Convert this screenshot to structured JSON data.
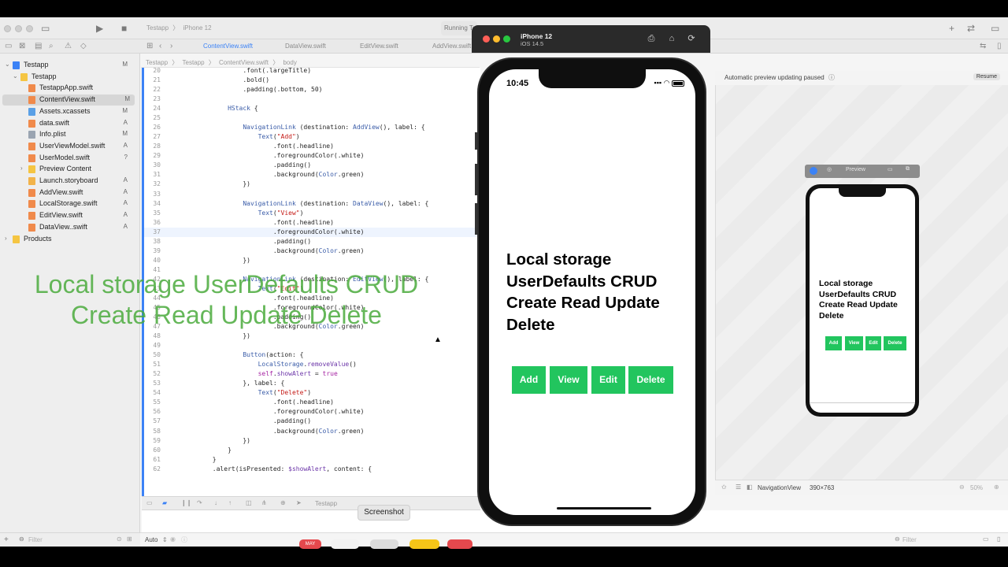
{
  "xcode": {
    "scheme": {
      "project": "Testapp",
      "device": "iPhone 12"
    },
    "running_status": "Running Te",
    "tabs": [
      {
        "label": "ContentView.swift",
        "active": true
      },
      {
        "label": "DataView.swift",
        "active": false
      },
      {
        "label": "EditView.swift",
        "active": false
      },
      {
        "label": "AddView.swift",
        "active": false
      }
    ],
    "breadcrumb": {
      "a": "Testapp",
      "b": "Testapp",
      "c": "ContentView.swift",
      "d": "body"
    },
    "navigator": [
      {
        "label": "Testapp",
        "badge": "M",
        "kind": "project",
        "level": 0,
        "disclosure": "open"
      },
      {
        "label": "Testapp",
        "badge": "",
        "kind": "folder",
        "level": 1,
        "disclosure": "open"
      },
      {
        "label": "TestappApp.swift",
        "badge": "",
        "kind": "swift",
        "level": 2
      },
      {
        "label": "ContentView.swift",
        "badge": "M",
        "kind": "swift",
        "level": 2,
        "selected": true
      },
      {
        "label": "Assets.xcassets",
        "badge": "M",
        "kind": "assets",
        "level": 2
      },
      {
        "label": "data.swift",
        "badge": "A",
        "kind": "swift",
        "level": 2
      },
      {
        "label": "Info.plist",
        "badge": "M",
        "kind": "plist",
        "level": 2
      },
      {
        "label": "UserViewModel.swift",
        "badge": "A",
        "kind": "swift",
        "level": 2
      },
      {
        "label": "UserModel.swift",
        "badge": "?",
        "kind": "swift",
        "level": 2
      },
      {
        "label": "Preview Content",
        "badge": "",
        "kind": "folder",
        "level": 2,
        "disclosure": "closed"
      },
      {
        "label": "Launch.storyboard",
        "badge": "A",
        "kind": "storyboard",
        "level": 2
      },
      {
        "label": "AddView.swift",
        "badge": "A",
        "kind": "swift",
        "level": 2
      },
      {
        "label": "LocalStorage.swift",
        "badge": "A",
        "kind": "swift",
        "level": 2
      },
      {
        "label": "EditView.swift",
        "badge": "A",
        "kind": "swift",
        "level": 2
      },
      {
        "label": "DataView..swift",
        "badge": "A",
        "kind": "swift",
        "level": 2
      },
      {
        "label": "Products",
        "badge": "",
        "kind": "folder",
        "level": 0,
        "disclosure": "closed"
      }
    ],
    "filter_placeholder": "Filter",
    "code_lines": [
      {
        "n": "20",
        "indent": 20,
        "tokens": [
          [
            ".font(.largeTitle)",
            ""
          ]
        ]
      },
      {
        "n": "21",
        "indent": 20,
        "tokens": [
          [
            ".bold()",
            ""
          ]
        ]
      },
      {
        "n": "22",
        "indent": 20,
        "tokens": [
          [
            ".padding(.bottom, 50)",
            ""
          ]
        ]
      },
      {
        "n": "23",
        "indent": 0,
        "tokens": []
      },
      {
        "n": "24",
        "indent": 16,
        "tokens": [
          [
            "HStack",
            "ty"
          ],
          [
            " {",
            ""
          ]
        ]
      },
      {
        "n": "25",
        "indent": 0,
        "tokens": []
      },
      {
        "n": "26",
        "indent": 20,
        "tokens": [
          [
            "NavigationLink",
            "ty"
          ],
          [
            " (destination: ",
            ""
          ],
          [
            "AddView",
            "ty"
          ],
          [
            "(), label: {",
            ""
          ]
        ]
      },
      {
        "n": "27",
        "indent": 24,
        "tokens": [
          [
            "Text",
            "ty"
          ],
          [
            "(",
            ""
          ],
          [
            "\"Add\"",
            "st"
          ],
          [
            ")",
            ""
          ]
        ]
      },
      {
        "n": "28",
        "indent": 28,
        "tokens": [
          [
            ".font(.headline)",
            ""
          ]
        ]
      },
      {
        "n": "29",
        "indent": 28,
        "tokens": [
          [
            ".foregroundColor(.white)",
            ""
          ]
        ]
      },
      {
        "n": "30",
        "indent": 28,
        "tokens": [
          [
            ".padding()",
            ""
          ]
        ]
      },
      {
        "n": "31",
        "indent": 28,
        "tokens": [
          [
            ".background(",
            ""
          ],
          [
            "Color",
            "ty"
          ],
          [
            ".green)",
            ""
          ]
        ]
      },
      {
        "n": "32",
        "indent": 20,
        "tokens": [
          [
            "})",
            ""
          ]
        ]
      },
      {
        "n": "33",
        "indent": 0,
        "tokens": []
      },
      {
        "n": "34",
        "indent": 20,
        "tokens": [
          [
            "NavigationLink",
            "ty"
          ],
          [
            " (destination: ",
            ""
          ],
          [
            "DataView",
            "ty"
          ],
          [
            "(), label: {",
            ""
          ]
        ]
      },
      {
        "n": "35",
        "indent": 24,
        "tokens": [
          [
            "Text",
            "ty"
          ],
          [
            "(",
            ""
          ],
          [
            "\"View\"",
            "st"
          ],
          [
            ")",
            ""
          ]
        ]
      },
      {
        "n": "36",
        "indent": 28,
        "tokens": [
          [
            ".font(.headline)",
            ""
          ]
        ]
      },
      {
        "n": "37",
        "indent": 28,
        "tokens": [
          [
            ".foregroundColor(.white)",
            ""
          ]
        ],
        "highlight": true
      },
      {
        "n": "38",
        "indent": 28,
        "tokens": [
          [
            ".padding()",
            ""
          ]
        ]
      },
      {
        "n": "39",
        "indent": 28,
        "tokens": [
          [
            ".background(",
            ""
          ],
          [
            "Color",
            "ty"
          ],
          [
            ".green)",
            ""
          ]
        ]
      },
      {
        "n": "40",
        "indent": 20,
        "tokens": [
          [
            "})",
            ""
          ]
        ]
      },
      {
        "n": "41",
        "indent": 0,
        "tokens": []
      },
      {
        "n": "42",
        "indent": 20,
        "tokens": [
          [
            "NavigationLink",
            "ty"
          ],
          [
            " (destination: ",
            ""
          ],
          [
            "EditView",
            "ty"
          ],
          [
            "(), label: {",
            ""
          ]
        ]
      },
      {
        "n": "43",
        "indent": 24,
        "tokens": [
          [
            "Text",
            "ty"
          ],
          [
            "(",
            ""
          ],
          [
            "\"Edit\"",
            "st"
          ],
          [
            ")",
            ""
          ]
        ]
      },
      {
        "n": "44",
        "indent": 28,
        "tokens": [
          [
            ".font(.headline)",
            ""
          ]
        ]
      },
      {
        "n": "45",
        "indent": 28,
        "tokens": [
          [
            ".foregroundColor(.white)",
            ""
          ]
        ]
      },
      {
        "n": "46",
        "indent": 28,
        "tokens": [
          [
            ".padding()",
            ""
          ]
        ]
      },
      {
        "n": "47",
        "indent": 28,
        "tokens": [
          [
            ".background(",
            ""
          ],
          [
            "Color",
            "ty"
          ],
          [
            ".green)",
            ""
          ]
        ]
      },
      {
        "n": "48",
        "indent": 20,
        "tokens": [
          [
            "})",
            ""
          ]
        ]
      },
      {
        "n": "49",
        "indent": 0,
        "tokens": []
      },
      {
        "n": "50",
        "indent": 20,
        "tokens": [
          [
            "Button",
            "ty"
          ],
          [
            "(action: {",
            ""
          ]
        ]
      },
      {
        "n": "51",
        "indent": 24,
        "tokens": [
          [
            "LocalStorage",
            "ty"
          ],
          [
            ".",
            ""
          ],
          [
            "removeValue",
            "fn"
          ],
          [
            "()",
            ""
          ]
        ]
      },
      {
        "n": "52",
        "indent": 24,
        "tokens": [
          [
            "self",
            "kw"
          ],
          [
            ".",
            ""
          ],
          [
            "showAlert",
            "fn"
          ],
          [
            " = ",
            ""
          ],
          [
            "true",
            "kw"
          ]
        ]
      },
      {
        "n": "53",
        "indent": 20,
        "tokens": [
          [
            "}, label: {",
            ""
          ]
        ]
      },
      {
        "n": "54",
        "indent": 24,
        "tokens": [
          [
            "Text",
            "ty"
          ],
          [
            "(",
            ""
          ],
          [
            "\"Delete\"",
            "st"
          ],
          [
            ")",
            ""
          ]
        ]
      },
      {
        "n": "55",
        "indent": 28,
        "tokens": [
          [
            ".font(.headline)",
            ""
          ]
        ]
      },
      {
        "n": "56",
        "indent": 28,
        "tokens": [
          [
            ".foregroundColor(.white)",
            ""
          ]
        ]
      },
      {
        "n": "57",
        "indent": 28,
        "tokens": [
          [
            ".padding()",
            ""
          ]
        ]
      },
      {
        "n": "58",
        "indent": 28,
        "tokens": [
          [
            ".background(",
            ""
          ],
          [
            "Color",
            "ty"
          ],
          [
            ".green)",
            ""
          ]
        ]
      },
      {
        "n": "59",
        "indent": 20,
        "tokens": [
          [
            "})",
            ""
          ]
        ]
      },
      {
        "n": "60",
        "indent": 16,
        "tokens": [
          [
            "}",
            ""
          ]
        ]
      },
      {
        "n": "61",
        "indent": 12,
        "tokens": [
          [
            "}",
            ""
          ]
        ]
      },
      {
        "n": "62",
        "indent": 12,
        "tokens": [
          [
            ".alert(isPresented: ",
            ""
          ],
          [
            "$showAlert",
            "fn"
          ],
          [
            ", content: {",
            ""
          ]
        ]
      }
    ],
    "debug_target": "Testapp",
    "console_mode": "Auto",
    "canvas": {
      "status": "Automatic preview updating paused",
      "resume_label": "Resume",
      "preview_label": "Preview",
      "footer_view": "NavigationView",
      "footer_size": "390×763",
      "zoom": "50%",
      "filter_placeholder": "Filter"
    },
    "mini_preview": {
      "title": "Local storage UserDefaults CRUD Create Read Update Delete",
      "buttons": [
        "Add",
        "View",
        "Edit",
        "Delete"
      ]
    }
  },
  "simulator": {
    "device": "iPhone 12",
    "os": "iOS 14.5",
    "time": "10:45",
    "title": "Local storage UserDefaults CRUD Create Read Update Delete",
    "buttons": [
      "Add",
      "View",
      "Edit",
      "Delete"
    ],
    "button_color": "#22c55e"
  },
  "overlay": {
    "line1": "Local storage UserDefaults CRUD",
    "line2": "Create Read Update Delete"
  },
  "tooltip": "Screenshot",
  "dock": {
    "calendar_month": "MAY"
  }
}
